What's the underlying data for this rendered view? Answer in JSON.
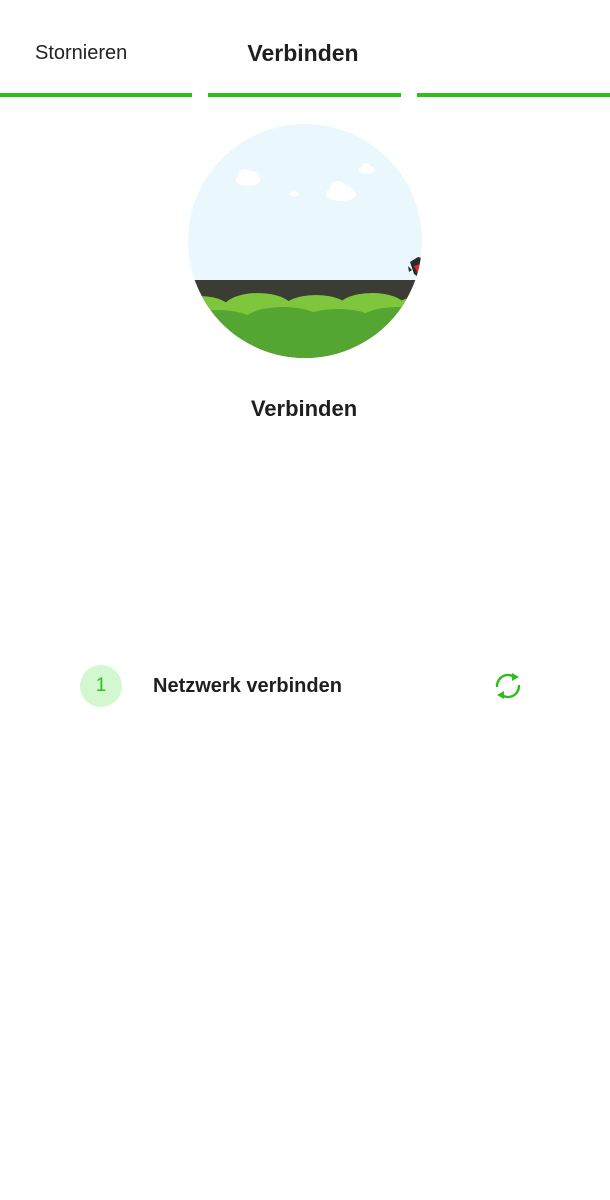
{
  "header": {
    "cancel_label": "Stornieren",
    "title": "Verbinden",
    "progress_steps": [
      {
        "state": "complete"
      },
      {
        "state": "complete"
      },
      {
        "state": "complete"
      }
    ]
  },
  "illustration": {
    "icon": "landscape-illustration"
  },
  "main": {
    "subtitle": "Verbinden"
  },
  "steps": [
    {
      "number": "1",
      "label": "Netzwerk verbinden",
      "action_icon": "refresh-icon"
    }
  ],
  "colors": {
    "accent": "#2ebd1f",
    "badge_bg": "#d3f7cf",
    "sky": "#eaf8fd",
    "ground_dark": "#3b3d35",
    "hill_light": "#7ec63b",
    "hill_dark": "#55a532",
    "text": "#1f1f1f"
  }
}
